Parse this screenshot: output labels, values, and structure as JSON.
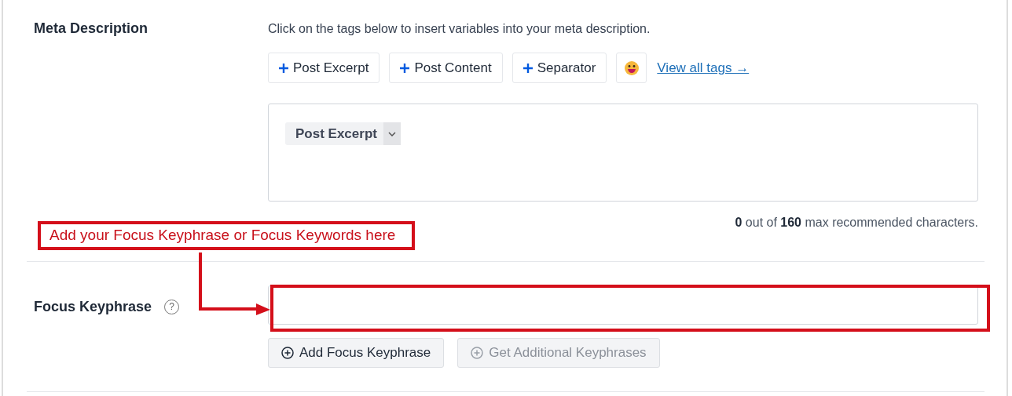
{
  "meta_description": {
    "label": "Meta Description",
    "hint": "Click on the tags below to insert variables into your meta description.",
    "tag_buttons": [
      {
        "label": "Post Excerpt"
      },
      {
        "label": "Post Content"
      },
      {
        "label": "Separator"
      }
    ],
    "view_all_link": "View all tags →",
    "editor": {
      "chips": [
        {
          "label": "Post Excerpt"
        }
      ]
    },
    "counter": "**0** out of **160** max recommended characters."
  },
  "focus_keyphrase": {
    "label": "Focus Keyphrase",
    "help_icon": "?",
    "buttons": [
      {
        "label": "Add Focus Keyphrase",
        "disabled": false
      },
      {
        "label": "Get Additional Keyphrases",
        "disabled": true
      }
    ]
  },
  "annotation": {
    "text": "Add your Focus Keyphrase or Focus Keywords here"
  }
}
